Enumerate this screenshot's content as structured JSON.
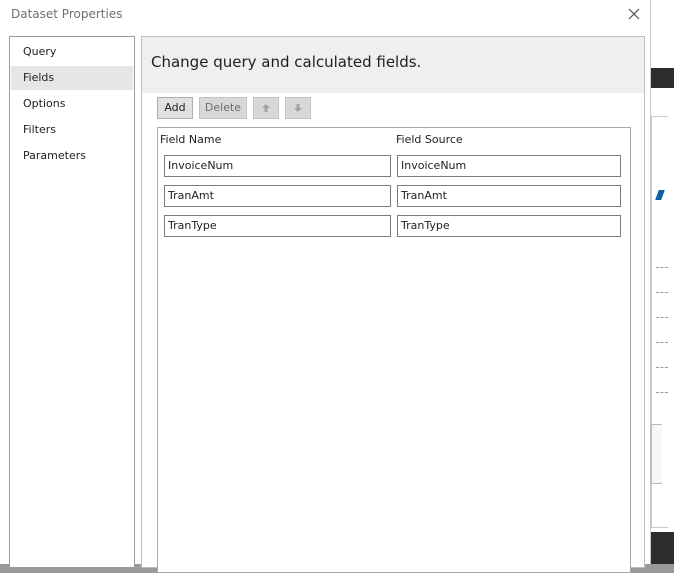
{
  "dialog": {
    "title": "Dataset Properties"
  },
  "nav": {
    "items": [
      {
        "label": "Query"
      },
      {
        "label": "Fields"
      },
      {
        "label": "Options"
      },
      {
        "label": "Filters"
      },
      {
        "label": "Parameters"
      }
    ],
    "selected": "Fields"
  },
  "main": {
    "heading": "Change query and calculated fields.",
    "toolbar": {
      "add_label": "Add",
      "delete_label": "Delete",
      "move_up_icon": "arrow-up-icon",
      "move_down_icon": "arrow-down-icon"
    },
    "grid": {
      "headers": {
        "field_name": "Field Name",
        "field_source": "Field Source"
      },
      "rows": [
        {
          "name": "InvoiceNum",
          "source": "InvoiceNum"
        },
        {
          "name": "TranAmt",
          "source": "TranAmt"
        },
        {
          "name": "TranType",
          "source": "TranType"
        }
      ]
    }
  },
  "colors": {
    "selected_nav_bg": "#e6e6e6",
    "header_bg": "#efefef",
    "button_bg": "#e1e1e1"
  }
}
